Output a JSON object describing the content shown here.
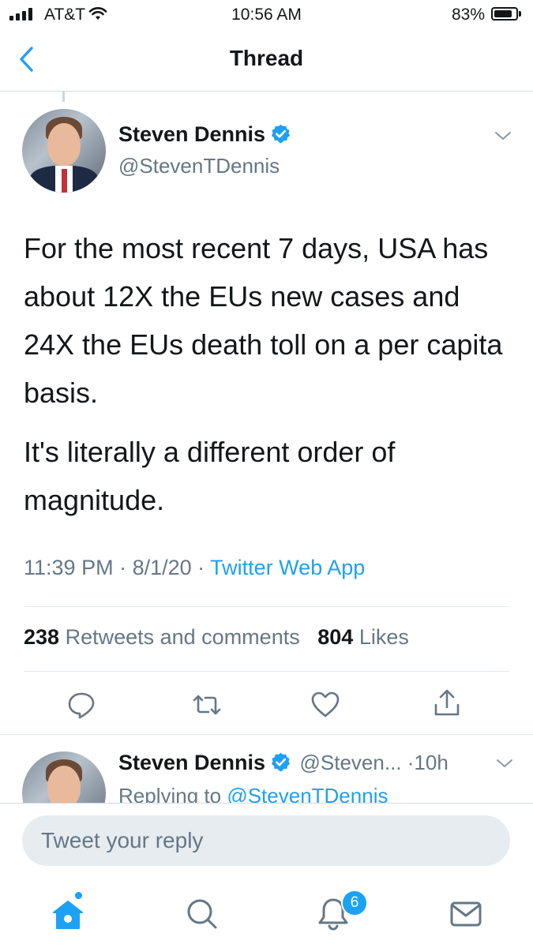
{
  "status_bar": {
    "carrier": "AT&T",
    "time": "10:56 AM",
    "battery": "83%",
    "battery_level": 0.83
  },
  "nav": {
    "title": "Thread",
    "back_icon": "chevron-left-icon"
  },
  "tweet": {
    "author_name": "Steven Dennis",
    "author_handle": "@StevenTDennis",
    "paragraphs": [
      "For the most recent 7 days, USA has about 12X the EUs new cases and 24X the EUs death toll on a per capita basis.",
      "It's literally a different order of magnitude."
    ],
    "time": "11:39 PM",
    "date": "8/1/20",
    "source": "Twitter Web App",
    "retweets_count": "238",
    "retweets_label": "Retweets and comments",
    "likes_count": "804",
    "likes_label": "Likes",
    "actions": [
      "reply-icon",
      "retweet-icon",
      "like-icon",
      "share-icon"
    ]
  },
  "reply_tweet": {
    "author_name": "Steven Dennis",
    "author_handle": "@Steven...",
    "age": "10h",
    "replying_prefix": "Replying to",
    "replying_to": "@StevenTDennis"
  },
  "composer": {
    "placeholder": "Tweet your reply"
  },
  "tab_bar": {
    "notifications_badge": "6",
    "tabs": [
      "home-icon",
      "search-icon",
      "notifications-icon",
      "messages-icon"
    ]
  },
  "colors": {
    "accent": "#1da1f2",
    "text": "#14171a",
    "secondary": "#657786"
  }
}
